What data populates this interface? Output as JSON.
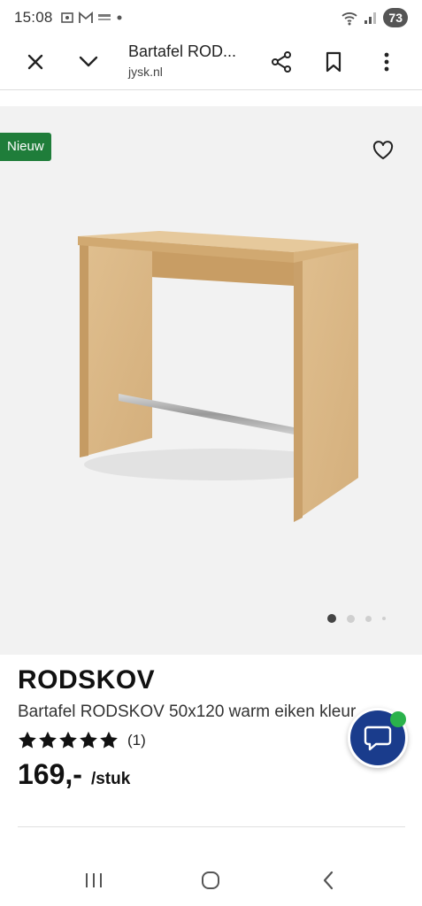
{
  "status_bar": {
    "time": "15:08",
    "battery": "73"
  },
  "browser": {
    "title": "Bartafel ROD...",
    "domain": "jysk.nl"
  },
  "gallery": {
    "badge": "Nieuw",
    "active_image": 1,
    "image_count": 4
  },
  "product": {
    "brand": "RODSKOV",
    "name": "Bartafel RODSKOV 50x120 warm eiken kleur",
    "rating": 5,
    "review_count": "(1)",
    "price": "169,-",
    "unit": "/stuk"
  },
  "colors": {
    "badge_green": "#1f7d3a",
    "chat_blue": "#1a3c8c",
    "online_green": "#2ab24b"
  }
}
